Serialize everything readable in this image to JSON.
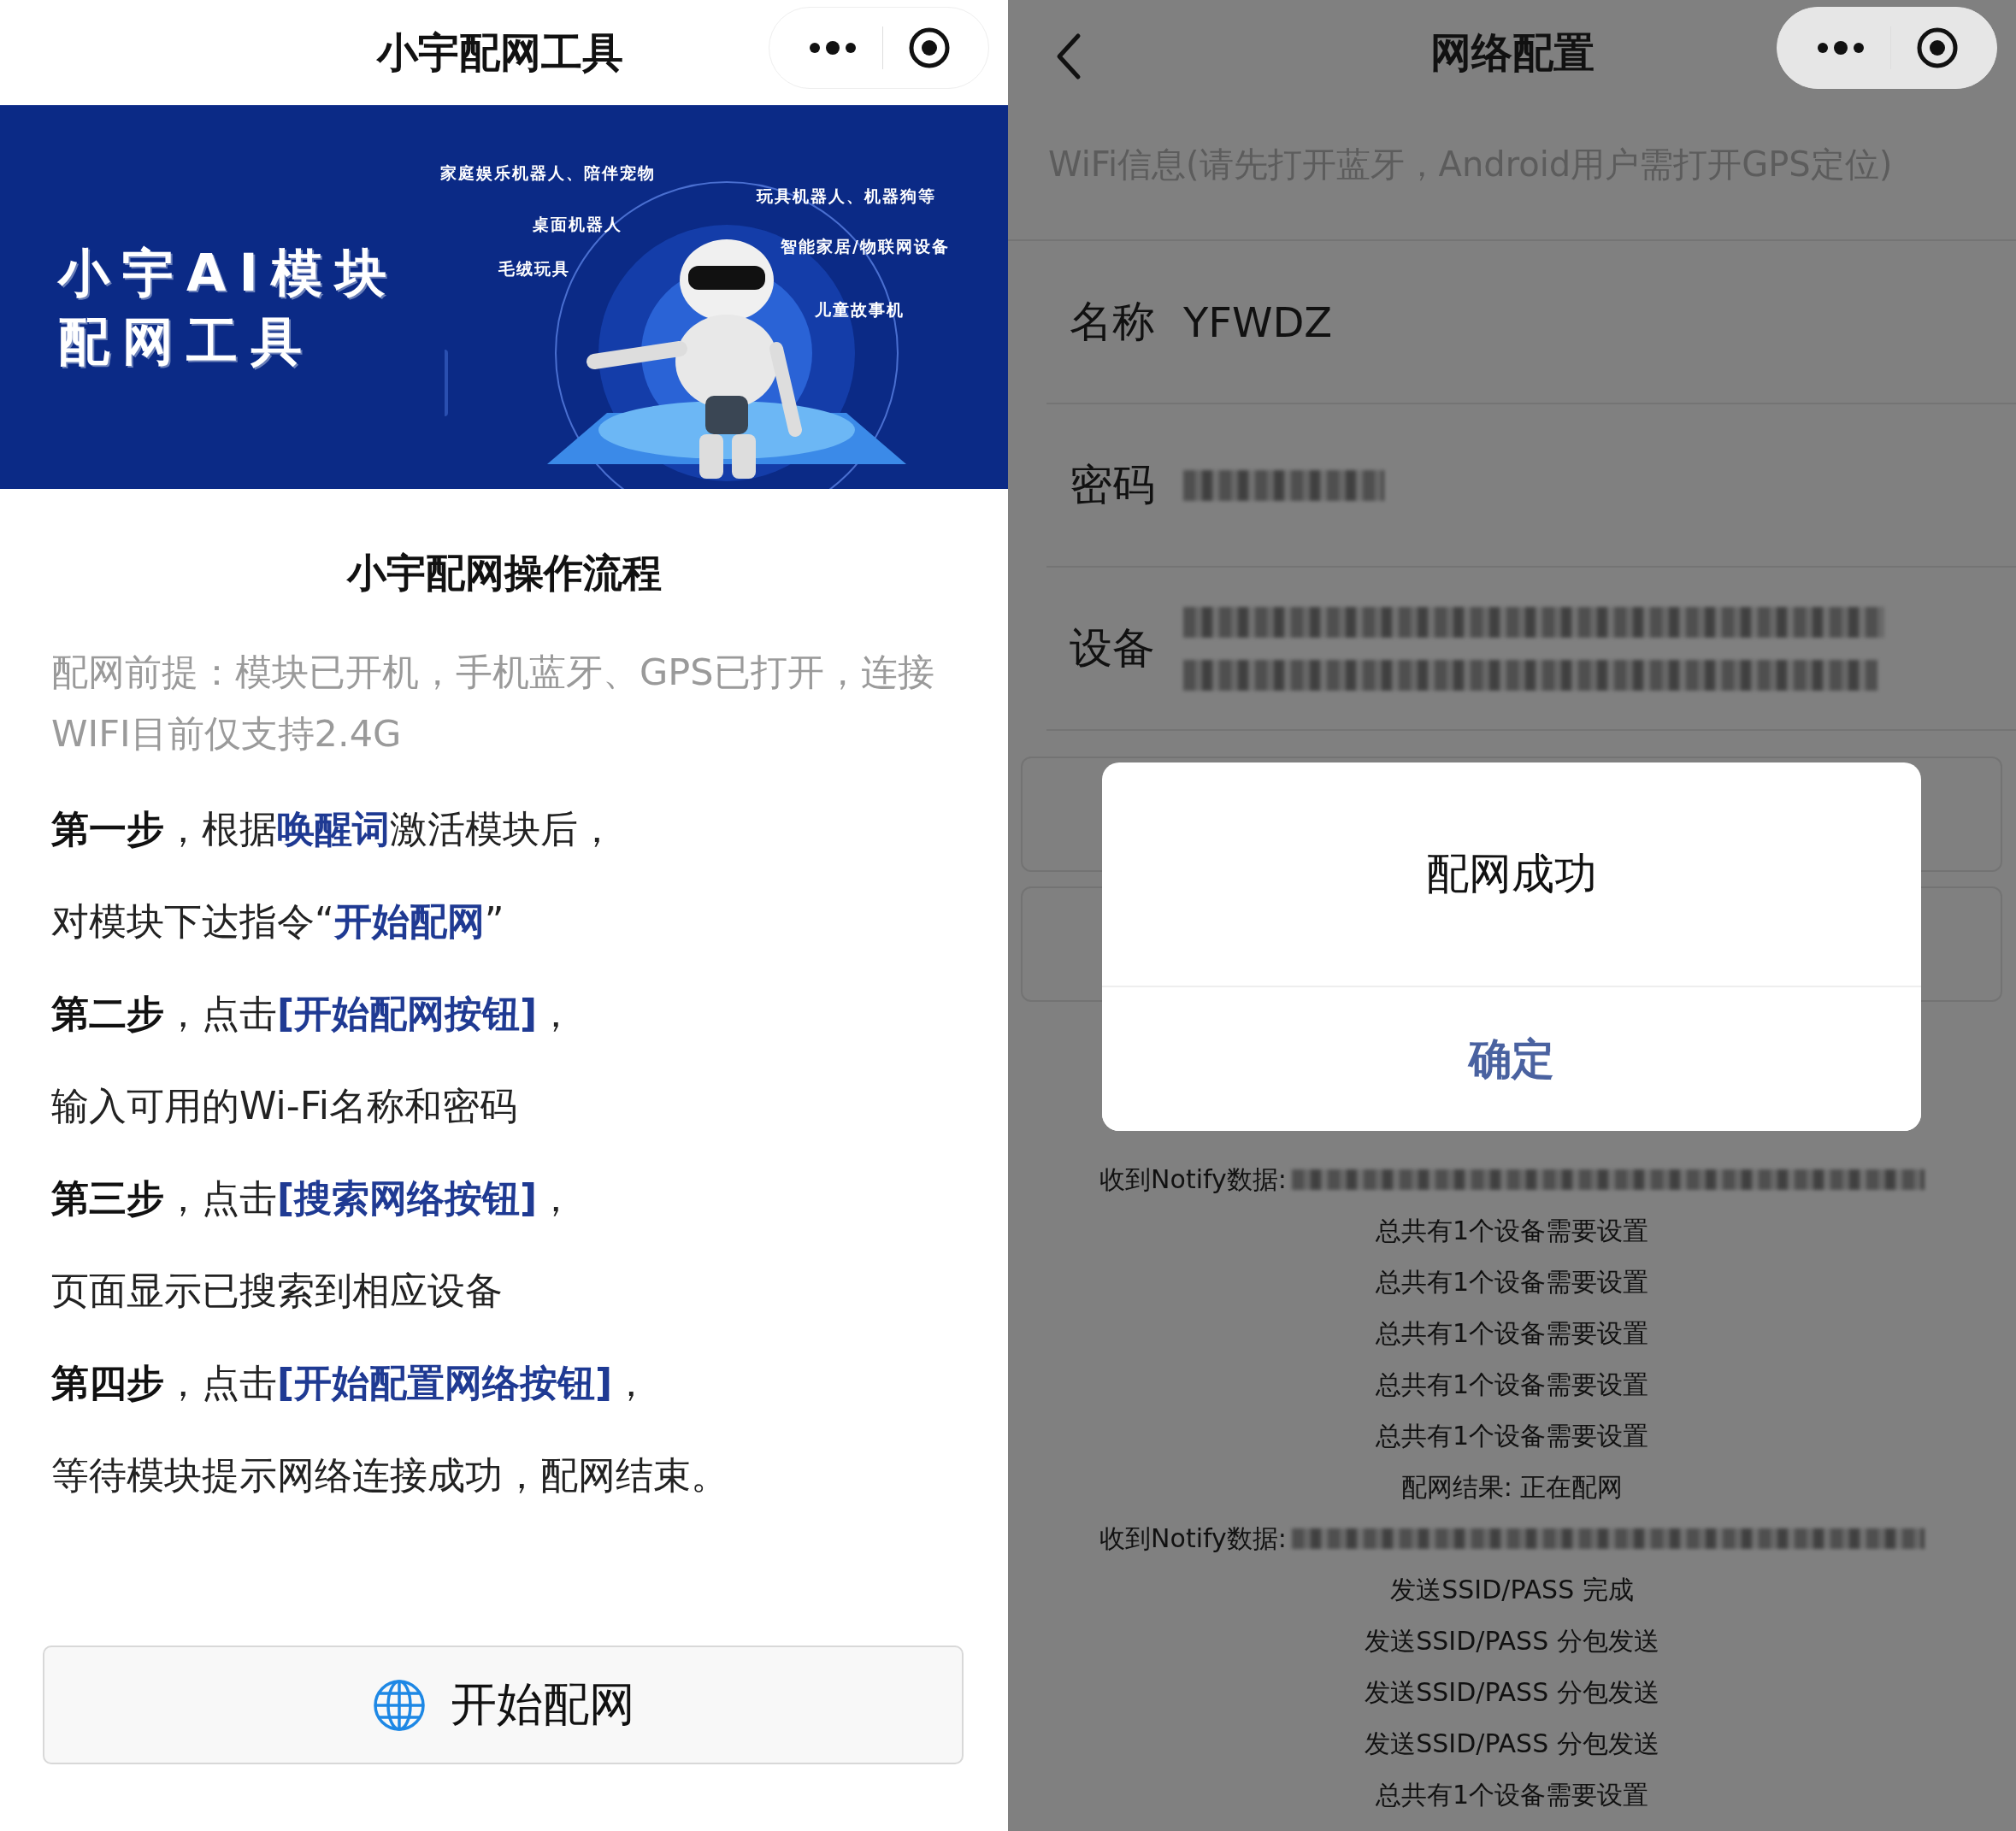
{
  "left": {
    "nav": {
      "title": "小宇配网工具"
    },
    "banner": {
      "title_lines": [
        "小宇AI模块",
        "配网工具"
      ],
      "tags": [
        "家庭娱乐机器人、陪伴宠物",
        "玩具机器人、机器狗等",
        "桌面机器人",
        "智能家居/物联网设备",
        "毛绒玩具",
        "儿童故事机"
      ]
    },
    "heading": "小宇配网操作流程",
    "note": "配网前提：模块已开机，手机蓝牙、GPS已打开，连接WIFI目前仅支持2.4G",
    "steps": [
      [
        {
          "kind": "bold",
          "text": "第一步"
        },
        {
          "kind": "plain",
          "text": "，根据"
        },
        {
          "kind": "link",
          "text": "唤醒词"
        },
        {
          "kind": "plain",
          "text": "激活模块后，"
        }
      ],
      [
        {
          "kind": "plain",
          "text": "对模块下达指令“"
        },
        {
          "kind": "link",
          "text": "开始配网"
        },
        {
          "kind": "plain",
          "text": "”"
        }
      ],
      [
        {
          "kind": "bold",
          "text": "第二步"
        },
        {
          "kind": "plain",
          "text": "，点击"
        },
        {
          "kind": "link",
          "text": "[开始配网按钮]"
        },
        {
          "kind": "plain",
          "text": "，"
        }
      ],
      [
        {
          "kind": "plain",
          "text": "输入可用的Wi-Fi名称和密码"
        }
      ],
      [
        {
          "kind": "bold",
          "text": "第三步"
        },
        {
          "kind": "plain",
          "text": "，点击"
        },
        {
          "kind": "link",
          "text": "[搜索网络按钮]"
        },
        {
          "kind": "plain",
          "text": "，"
        }
      ],
      [
        {
          "kind": "plain",
          "text": "页面显示已搜索到相应设备"
        }
      ],
      [
        {
          "kind": "bold",
          "text": "第四步"
        },
        {
          "kind": "plain",
          "text": "，点击"
        },
        {
          "kind": "link",
          "text": "[开始配置网络按钮]"
        },
        {
          "kind": "plain",
          "text": "，"
        }
      ],
      [
        {
          "kind": "plain",
          "text": "等待模块提示网络连接成功，配网结束。"
        }
      ]
    ],
    "button": "开始配网"
  },
  "right": {
    "nav": {
      "title": "网络配置"
    },
    "wifi_hint": "WiFi信息(请先打开蓝牙，Android用户需打开GPS定位)",
    "fields": [
      {
        "label": "名称",
        "value": "YFWDZ",
        "kind": "value"
      },
      {
        "label": "密码",
        "kind": "masked_short"
      },
      {
        "label": "设备",
        "kind": "masked_long"
      }
    ],
    "dialog": {
      "message": "配网成功",
      "confirm": "确定"
    },
    "log": [
      {
        "kind": "notify",
        "label": "收到Notify数据:"
      },
      {
        "kind": "text",
        "text": "总共有1个设备需要设置"
      },
      {
        "kind": "text",
        "text": "总共有1个设备需要设置"
      },
      {
        "kind": "text",
        "text": "总共有1个设备需要设置"
      },
      {
        "kind": "text",
        "text": "总共有1个设备需要设置"
      },
      {
        "kind": "text",
        "text": "总共有1个设备需要设置"
      },
      {
        "kind": "text",
        "text": "配网结果: 正在配网"
      },
      {
        "kind": "notify",
        "label": "收到Notify数据:"
      },
      {
        "kind": "text",
        "text": "发送SSID/PASS 完成"
      },
      {
        "kind": "text",
        "text": "发送SSID/PASS 分包发送"
      },
      {
        "kind": "text",
        "text": "发送SSID/PASS 分包发送"
      },
      {
        "kind": "text",
        "text": "发送SSID/PASS 分包发送"
      },
      {
        "kind": "text",
        "text": "总共有1个设备需要设置"
      }
    ]
  }
}
